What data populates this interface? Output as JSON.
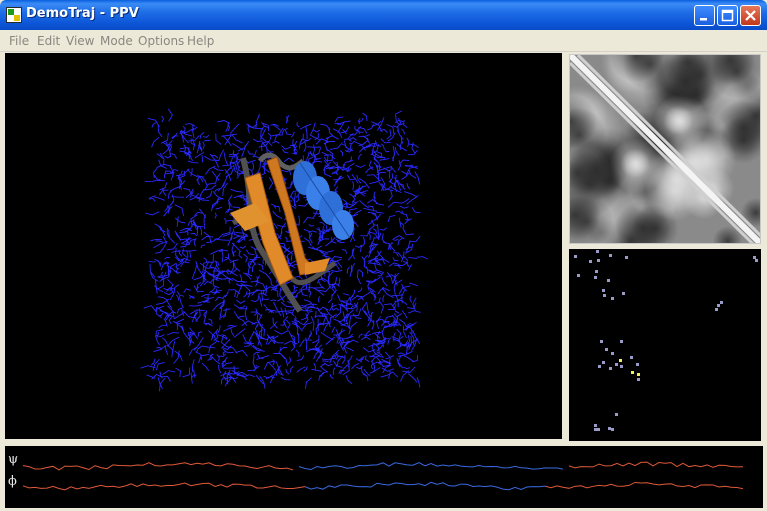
{
  "window": {
    "title": "DemoTraj - PPV",
    "icon": "ppv-app-icon",
    "controls": [
      "minimize-icon",
      "maximize-icon",
      "close-icon"
    ]
  },
  "menu": {
    "items": [
      "File",
      "Edit",
      "View",
      "Mode",
      "Options",
      "Help"
    ]
  },
  "panels": {
    "structure_view": "molecule-3d-view",
    "distance_map": "distance-map-image",
    "ramachandran_plot": "ramachandran-plot",
    "timeline": "dihedral-timeline"
  },
  "timeline": {
    "psi_label": "ψ",
    "phi_label": "ϕ"
  },
  "colors": {
    "title_bar": "#0b54d6",
    "water": "#2a2aff",
    "helix": "#3a7fe0",
    "sheet": "#e08a2a",
    "coil": "#606060",
    "timeline_red": "#e05a3a",
    "timeline_blue": "#3a6ae0",
    "rama_point": "#9a9ac8",
    "rama_highlight": "#f0f060"
  }
}
